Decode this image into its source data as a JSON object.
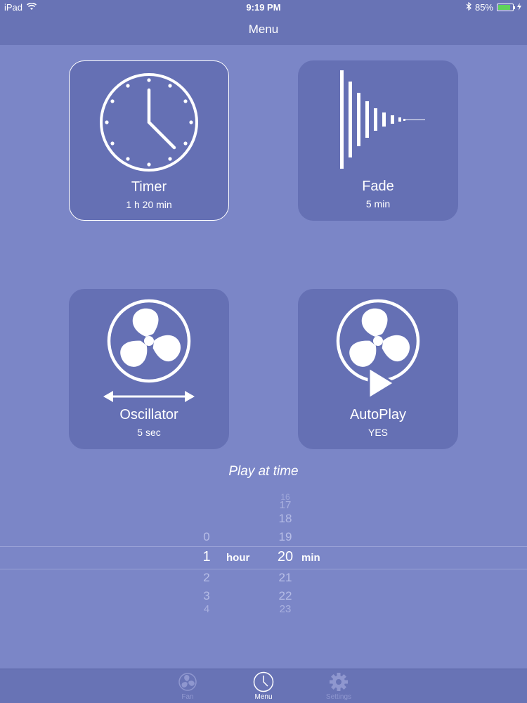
{
  "status": {
    "device": "iPad",
    "time": "9:19 PM",
    "battery": "85%",
    "battery_level": 0.85
  },
  "nav": {
    "title": "Menu"
  },
  "tiles": {
    "timer": {
      "title": "Timer",
      "value": "1 h 20 min",
      "selected": true
    },
    "fade": {
      "title": "Fade",
      "value": "5 min"
    },
    "oscillator": {
      "title": "Oscillator",
      "value": "5 sec"
    },
    "autoplay": {
      "title": "AutoPlay",
      "value": "YES"
    }
  },
  "play_at_time": {
    "label": "Play at time",
    "hour_unit": "hour",
    "min_unit": "min",
    "hours": [
      "0",
      "1",
      "2",
      "3",
      "4"
    ],
    "hour_selected": "1",
    "minutes": [
      "16",
      "17",
      "18",
      "19",
      "20",
      "21",
      "22",
      "23"
    ],
    "minute_selected": "20"
  },
  "tabbar": {
    "tabs": [
      {
        "label": "Fan",
        "icon": "fan-icon",
        "active": false
      },
      {
        "label": "Menu",
        "icon": "clock-icon",
        "active": true
      },
      {
        "label": "Settings",
        "icon": "gear-icon",
        "active": false
      }
    ]
  }
}
